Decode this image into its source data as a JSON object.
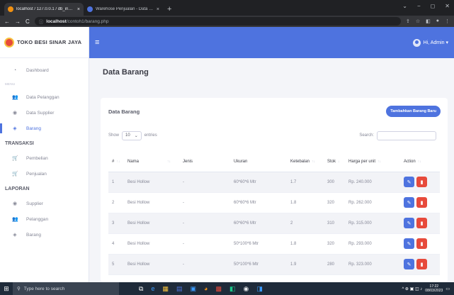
{
  "browser": {
    "tabs": [
      {
        "title": "localhost / 127.0.0.1 / db_inmon",
        "close": "×",
        "active": true,
        "favicon_color": "#f29111"
      },
      {
        "title": "Warehose Penjualan - Data Baran",
        "close": "×",
        "active": false,
        "favicon_color": "#4e73df"
      }
    ],
    "new_tab": "+",
    "window_controls": [
      "⌄",
      "−",
      "◻",
      "✕"
    ],
    "url_host": "localhost",
    "url_path": "/contoh1/barang.php",
    "nav_back": "←",
    "nav_forward": "→",
    "nav_reload": "C",
    "lock_icon": "ⓘ",
    "right_icons": [
      "⇪",
      "☆",
      "◧",
      "●",
      "⋮"
    ]
  },
  "sidebar": {
    "brand": "TOKO BESI SINAR JAYA",
    "items": [
      {
        "label": "Dashboard",
        "icon": "◔",
        "name": "dashboard",
        "active": false
      }
    ],
    "menu_heading": "MENU",
    "menu_items": [
      {
        "label": "Data Pelanggan",
        "icon": "👥",
        "name": "data-pelanggan",
        "active": false
      },
      {
        "label": "Data Supplier",
        "icon": "◉",
        "name": "data-supplier",
        "active": false
      },
      {
        "label": "Barang",
        "icon": "◈",
        "name": "barang",
        "active": true
      }
    ],
    "transaksi_heading": "TRANSAKSI",
    "transaksi_items": [
      {
        "label": "Pembelian",
        "icon": "🛒",
        "name": "pembelian",
        "active": false
      },
      {
        "label": "Penjualan",
        "icon": "🛒",
        "name": "penjualan",
        "active": false
      }
    ],
    "laporan_heading": "LAPORAN",
    "laporan_items": [
      {
        "label": "Supplier",
        "icon": "◉",
        "name": "laporan-supplier",
        "active": false
      },
      {
        "label": "Pelanggan",
        "icon": "👥",
        "name": "laporan-pelanggan",
        "active": false
      },
      {
        "label": "Barang",
        "icon": "◈",
        "name": "laporan-barang",
        "active": false
      }
    ]
  },
  "topbar": {
    "menu_icon": "≡",
    "user_label": "Hi, Admin ▾"
  },
  "main": {
    "page_title": "Data Barang",
    "card_title": "Data Barang",
    "add_button": "Tambahkan Barang Baru",
    "show_label": "Show",
    "entries_value": "10",
    "entries_caret": "⌄",
    "entries_label": "entries",
    "search_label": "Search:",
    "search_value": "",
    "columns": [
      "#",
      "Nama",
      "Jenis",
      "Ukuran",
      "Ketebalan",
      "Stok",
      "Harga per unit",
      "Action"
    ],
    "rows": [
      [
        "1",
        "Besi Hollow",
        "-",
        "60*60*6 Mtr",
        "1.7",
        "300",
        "Rp. 240.000"
      ],
      [
        "2",
        "Besi Hollow",
        "-",
        "60*60*6 Mtr",
        "1.8",
        "320",
        "Rp. 262.000"
      ],
      [
        "3",
        "Besi Hollow",
        "-",
        "60*60*6 Mtr",
        "2",
        "310",
        "Rp. 315.000"
      ],
      [
        "4",
        "Besi Hollow",
        "-",
        "50*100*6 Mtr",
        "1.8",
        "320",
        "Rp. 293.000"
      ],
      [
        "5",
        "Besi Hollow",
        "-",
        "50*100*6 Mtr",
        "1.9",
        "280",
        "Rp. 323.000"
      ]
    ],
    "edit_icon": "✎",
    "delete_icon": "▮"
  },
  "taskbar": {
    "start_icon": "⊞",
    "search_placeholder": "Type here to search",
    "search_icon": "⚲",
    "apps": [
      "⧉",
      "e",
      "▦",
      "▤",
      "▣",
      "◕",
      "▩",
      "◧",
      "◉",
      "◨"
    ],
    "tray_icons": "^ ⊕ ▣ ◫ ♪",
    "time": "17:22",
    "date": "08/03/2023"
  },
  "colors": {
    "primary": "#4e73df",
    "danger": "#e74a3b",
    "page_bg": "#f4f5f9"
  }
}
